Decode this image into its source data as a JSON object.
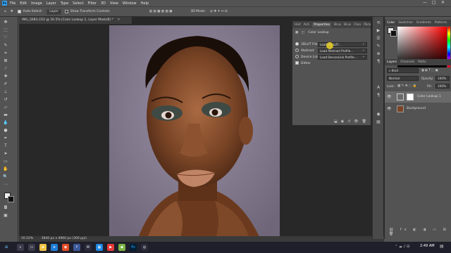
{
  "menubar": {
    "app_logo": "Ps",
    "items": [
      "File",
      "Edit",
      "Image",
      "Layer",
      "Type",
      "Select",
      "Filter",
      "3D",
      "View",
      "Window",
      "Help"
    ],
    "window_controls": [
      "—",
      "□",
      "✕"
    ]
  },
  "options_bar": {
    "auto_select_label": "Auto-Select:",
    "auto_select_value": "Layer",
    "show_transform_label": "Show Transform Controls",
    "mode_label": "3D Mode:"
  },
  "document": {
    "tab_title": "IMG_5083.CR2 @ 16.5% (Color Lookup 1, Layer Mask/8) *",
    "zoom": "16.52%",
    "doc_info": "3840 px x 4960 px (300 ppi)"
  },
  "properties_panel": {
    "tabs": [
      "Hist",
      "Acti",
      "Properties",
      "Brus",
      "Brus",
      "Clon",
      "Para"
    ],
    "active_tab_index": 2,
    "title": "Color Lookup",
    "rows": [
      {
        "label": "3DLUT File",
        "dropdown": "Load 3D LUT...",
        "selected": true
      },
      {
        "label": "Abstract",
        "dropdown": "Load Abstract Profile...",
        "selected": false
      },
      {
        "label": "Device Link",
        "dropdown": "Load DeviceLink Profile...",
        "selected": false
      }
    ],
    "dither_label": "Dither",
    "dither_checked": true
  },
  "right_panels": {
    "color_tabs": [
      "Color",
      "Swatches",
      "Gradients",
      "Patterns"
    ],
    "layers_tabs": [
      "Layers",
      "Channels",
      "Paths"
    ],
    "kind_label": "Kind",
    "blend_mode": "Normal",
    "opacity_label": "Opacity:",
    "opacity_value": "100%",
    "lock_label": "Lock:",
    "fill_label": "Fill:",
    "fill_value": "100%",
    "layers": [
      {
        "name": "Color Lookup 1",
        "selected": true
      },
      {
        "name": "Background",
        "selected": false
      }
    ]
  },
  "taskbar": {
    "time": "2:49 AM"
  },
  "colors": {
    "accent": "#2fa3f6",
    "panel_bg": "#535353",
    "canvas_bg": "#282828"
  }
}
